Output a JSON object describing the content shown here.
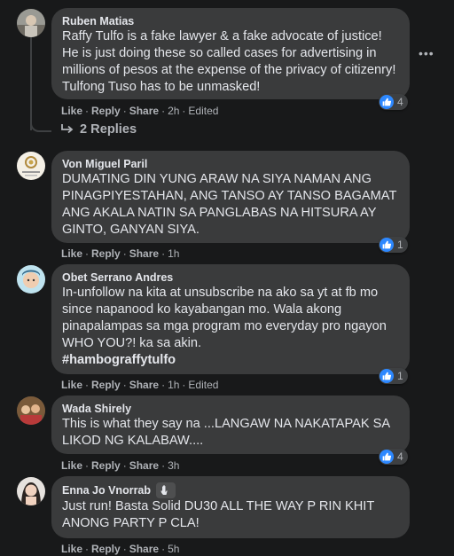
{
  "comments": [
    {
      "author": "Ruben Matias",
      "text": "Raffy Tulfo is a fake lawyer & a fake advocate of justice! He is just doing these so called cases for advertising in millions of pesos at the expense of the privacy of citizenry! Tulfong Tuso has to be unmasked!",
      "like": "Like",
      "reply": "Reply",
      "share": "Share",
      "time": "2h",
      "edited": "Edited",
      "reactions": "4"
    },
    {
      "author": "Von Miguel Paril",
      "text": "DUMATING DIN YUNG ARAW NA SIYA NAMAN ANG PINAGPIYESTAHAN, ANG TANSO AY TANSO BAGAMAT ANG AKALA NATIN SA PANGLABAS NA HITSURA AY GINTO, GANYAN SIYA.",
      "like": "Like",
      "reply": "Reply",
      "share": "Share",
      "time": "1h",
      "reactions": "1"
    },
    {
      "author": "Obet Serrano Andres",
      "text": "In-unfollow na kita at unsubscribe na ako sa yt at fb mo since napanood ko kayabangan mo. Wala akong pinapalampas sa mga program mo everyday pro ngayon WHO YOU?! ka sa akin.",
      "hashtag": "#hambograffytulfo",
      "like": "Like",
      "reply": "Reply",
      "share": "Share",
      "time": "1h",
      "edited": "Edited",
      "reactions": "1"
    },
    {
      "author": "Wada Shirely",
      "text": "This is what they say na ...LANGAW NA NAKATAPAK SA LIKOD NG KALABAW....",
      "like": "Like",
      "reply": "Reply",
      "share": "Share",
      "time": "3h",
      "reactions": "4"
    },
    {
      "author": "Enna Jo Vnorrab",
      "text": "Just run! Basta Solid DU30 ALL THE WAY P RIN KHIT ANONG PARTY P CLA!",
      "like": "Like",
      "reply": "Reply",
      "share": "Share",
      "time": "5h"
    }
  ],
  "replies_label": "2 Replies",
  "colors": {
    "background": "#18191a",
    "bubble": "#3a3b3c",
    "like_blue": "#2d88ff",
    "muted": "#b0b3b8"
  }
}
